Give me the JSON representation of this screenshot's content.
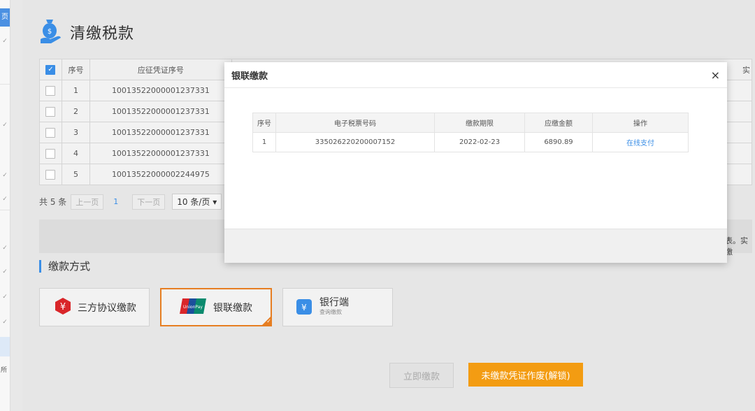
{
  "sidebar": {
    "active_label": "页",
    "bottom_label": "所"
  },
  "page": {
    "title": "清缴税款"
  },
  "table": {
    "headers": {
      "index": "序号",
      "voucher": "应征凭证序号",
      "right_partial": "实"
    },
    "rows": [
      {
        "index": "1",
        "voucher": "10013522000001237331"
      },
      {
        "index": "2",
        "voucher": "10013522000001237331"
      },
      {
        "index": "3",
        "voucher": "10013522000001237331"
      },
      {
        "index": "4",
        "voucher": "10013522000001237331"
      },
      {
        "index": "5",
        "voucher": "10013522000002244975"
      }
    ]
  },
  "pager": {
    "total": "共 5 条",
    "prev": "上一页",
    "current": "1",
    "next": "下一页",
    "page_size": "10 条/页"
  },
  "notice_partial": "表。实缴",
  "payment": {
    "section_title": "缴款方式",
    "options": [
      {
        "label": "三方协议缴款"
      },
      {
        "label": "银联缴款",
        "logo_text": "UnionPay 银联"
      },
      {
        "label": "银行端",
        "sub": "查询缴款"
      }
    ]
  },
  "actions": {
    "pay_now": "立即缴款",
    "void_voucher": "未缴款凭证作废(解锁)"
  },
  "modal": {
    "title": "银联缴款",
    "close": "×",
    "headers": {
      "index": "序号",
      "ticket": "电子税票号码",
      "period": "缴款期限",
      "amount": "应缴金额",
      "op": "操作"
    },
    "rows": [
      {
        "index": "1",
        "ticket": "335026220200007152",
        "period": "2022-02-23",
        "amount": "6890.89",
        "op": "在线支付"
      }
    ]
  },
  "colors": {
    "accent": "#3a8ee6",
    "orange": "#f39c12",
    "unionpay_red": "#d9262a"
  }
}
